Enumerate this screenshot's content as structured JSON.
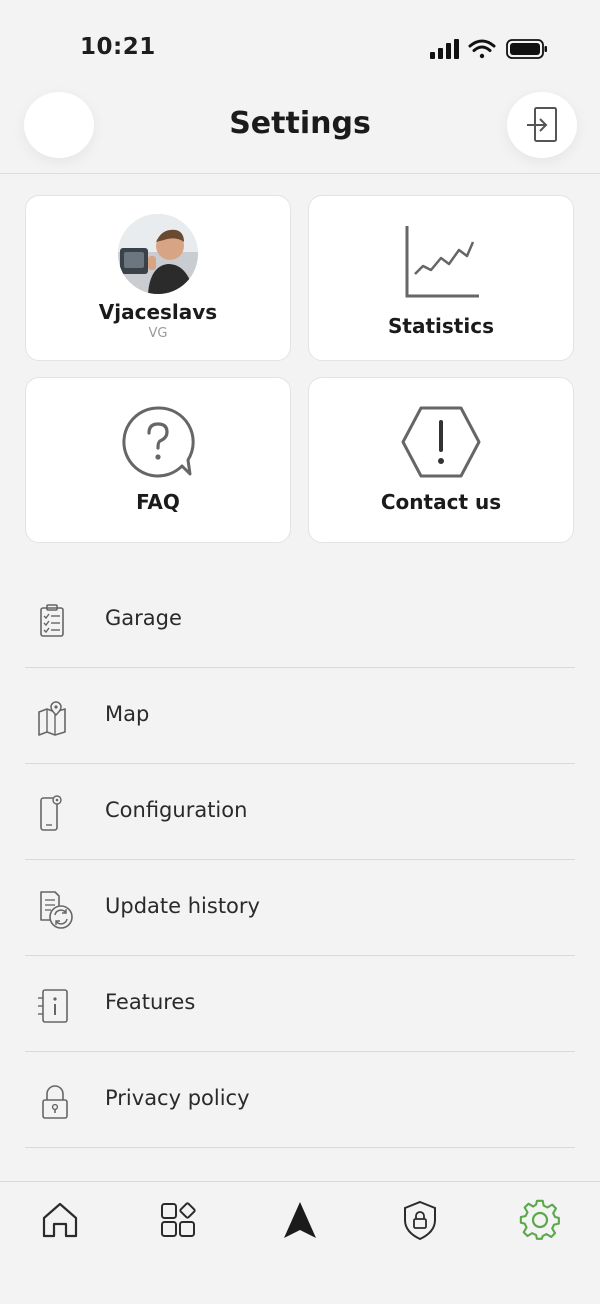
{
  "status_bar": {
    "time": "10:21"
  },
  "header": {
    "title": "Settings",
    "left_button_icon": "blank-circle",
    "right_button_icon": "login-icon"
  },
  "cards": {
    "profile": {
      "name": "Vjaceslavs",
      "initials": "VG",
      "icon": "avatar-photo"
    },
    "statistics": {
      "label": "Statistics",
      "icon": "line-chart-icon"
    },
    "faq": {
      "label": "FAQ",
      "icon": "question-bubble-icon"
    },
    "contact": {
      "label": "Contact us",
      "icon": "hexagon-exclamation-icon"
    }
  },
  "menu": {
    "items": [
      {
        "label": "Garage",
        "icon": "clipboard-checklist-icon"
      },
      {
        "label": "Map",
        "icon": "map-pin-icon"
      },
      {
        "label": "Configuration",
        "icon": "phone-settings-icon"
      },
      {
        "label": "Update history",
        "icon": "document-refresh-icon"
      },
      {
        "label": "Features",
        "icon": "info-document-icon"
      },
      {
        "label": "Privacy policy",
        "icon": "lock-icon"
      }
    ]
  },
  "tab_bar": {
    "tabs": [
      {
        "name": "home",
        "icon": "home-icon"
      },
      {
        "name": "apps",
        "icon": "apps-grid-icon"
      },
      {
        "name": "navigate",
        "icon": "navigation-arrow-icon"
      },
      {
        "name": "security",
        "icon": "shield-lock-icon"
      },
      {
        "name": "settings",
        "icon": "gear-icon",
        "active": true
      }
    ],
    "active_color": "#5aa84a"
  }
}
